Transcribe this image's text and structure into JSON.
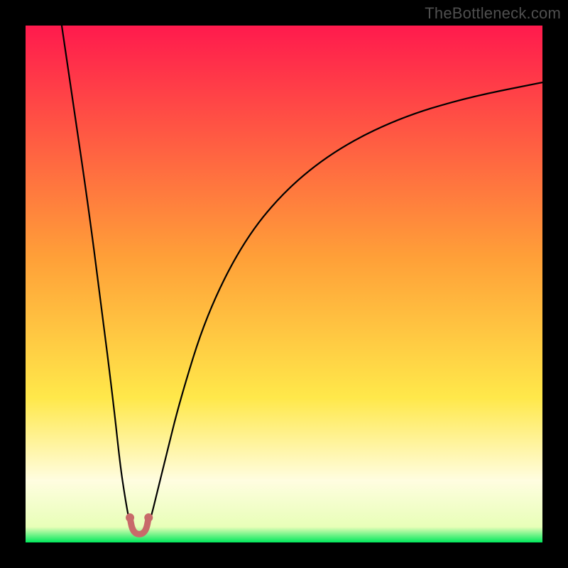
{
  "watermark": "TheBottleneck.com",
  "chart_data": {
    "type": "line",
    "title": "",
    "xlabel": "",
    "ylabel": "",
    "xlim": [
      0,
      100
    ],
    "ylim": [
      0,
      100
    ],
    "grid": false,
    "legend": false,
    "gradient_stops": [
      {
        "offset": 0.0,
        "color": "#ff1a4d"
      },
      {
        "offset": 0.45,
        "color": "#ffa038"
      },
      {
        "offset": 0.72,
        "color": "#ffe84a"
      },
      {
        "offset": 0.88,
        "color": "#fffde0"
      },
      {
        "offset": 0.97,
        "color": "#e8ffb8"
      },
      {
        "offset": 1.0,
        "color": "#00e85c"
      }
    ],
    "series": [
      {
        "name": "left-branch",
        "x": [
          7.0,
          9.5,
          12.0,
          14.5,
          17.0,
          18.3,
          19.2,
          19.9,
          20.4
        ],
        "y": [
          100,
          83,
          66,
          47,
          27,
          15,
          9,
          5,
          2.8
        ],
        "stroke": "#000000",
        "width": 2.2
      },
      {
        "name": "right-branch",
        "x": [
          23.6,
          24.3,
          25.3,
          27.0,
          30.0,
          35.0,
          42.0,
          50.0,
          60.0,
          72.0,
          85.0,
          100.0
        ],
        "y": [
          2.8,
          5,
          9,
          16,
          28,
          44,
          58,
          68,
          76,
          82,
          86,
          89
        ],
        "stroke": "#000000",
        "width": 2.2
      },
      {
        "name": "valley-marker",
        "x": [
          20.2,
          20.6,
          21.4,
          22.6,
          23.4,
          23.8
        ],
        "y": [
          4.8,
          2.6,
          1.6,
          1.6,
          2.6,
          4.8
        ],
        "stroke": "#c86a6a",
        "width": 9
      }
    ]
  }
}
